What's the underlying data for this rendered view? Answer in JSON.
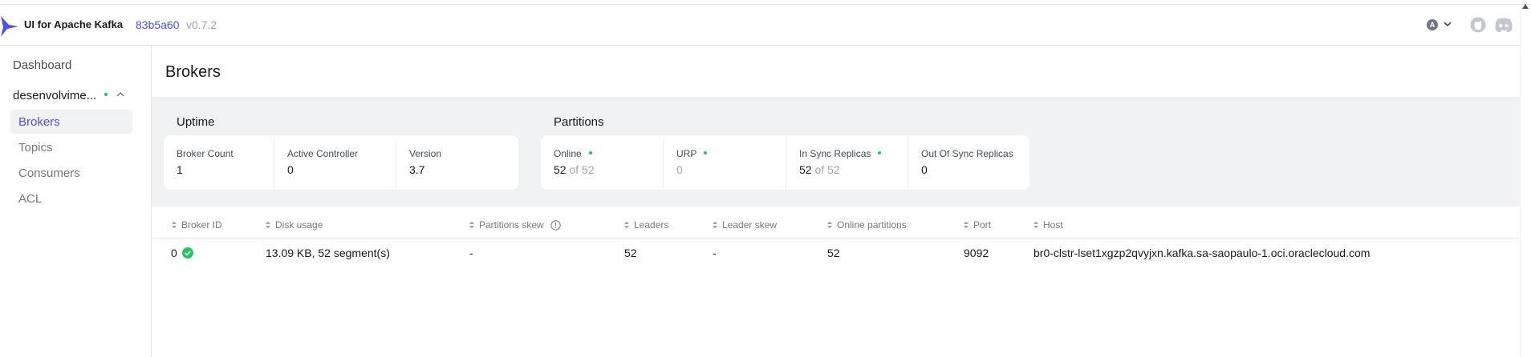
{
  "header": {
    "app_title": "UI for Apache Kafka",
    "commit": "83b5a60",
    "version": "v0.7.2",
    "avatar_letter": "A",
    "icons": [
      "kafka-logo-icon",
      "chevron-down-icon",
      "github-icon",
      "discord-icon"
    ]
  },
  "sidebar": {
    "dashboard_label": "Dashboard",
    "cluster": {
      "label": "desenvolvime...",
      "status_color": "#22c55e"
    },
    "items": [
      {
        "label": "Brokers",
        "active": true
      },
      {
        "label": "Topics",
        "active": false
      },
      {
        "label": "Consumers",
        "active": false
      },
      {
        "label": "ACL",
        "active": false
      }
    ]
  },
  "page": {
    "title": "Brokers"
  },
  "stats": {
    "uptime": {
      "title": "Uptime",
      "cards": [
        {
          "label": "Broker Count",
          "value": "1"
        },
        {
          "label": "Active Controller",
          "value": "0"
        },
        {
          "label": "Version",
          "value": "3.7"
        }
      ]
    },
    "partitions": {
      "title": "Partitions",
      "cards": [
        {
          "label": "Online",
          "value": "52",
          "suffix": "of 52"
        },
        {
          "label": "URP",
          "value": "0"
        },
        {
          "label": "In Sync Replicas",
          "value": "52",
          "suffix": "of 52"
        },
        {
          "label": "Out Of Sync Replicas",
          "value": "0"
        }
      ]
    }
  },
  "table": {
    "columns": [
      "Broker ID",
      "Disk usage",
      "Partitions skew",
      "Leaders",
      "Leader skew",
      "Online partitions",
      "Port",
      "Host"
    ],
    "rows": [
      {
        "broker_id": "0",
        "disk_usage": "13.09 KB, 52 segment(s)",
        "partitions_skew": "-",
        "leaders": "52",
        "leader_skew": "-",
        "online_partitions": "52",
        "port": "9092",
        "host": "br0-clstr-lset1xgzp2qvyjxn.kafka.sa-saopaulo-1.oci.oraclecloud.com"
      }
    ]
  },
  "colors": {
    "accent": "#4f4ff0",
    "success": "#22c55e",
    "panel_bg": "#f1f2f3"
  }
}
